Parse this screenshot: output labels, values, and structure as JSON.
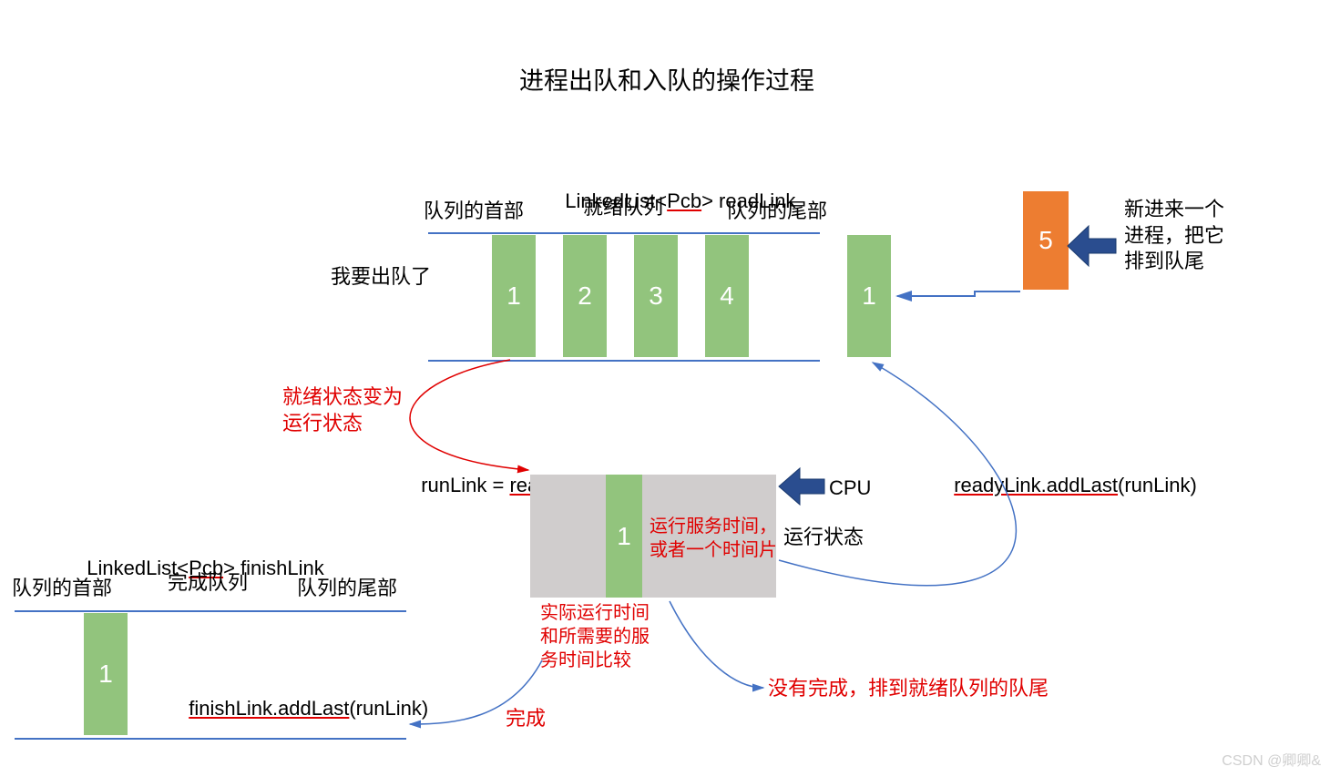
{
  "title": "进程出队和入队的操作过程",
  "readyQueue": {
    "declaration_prefix": "LinkedList<",
    "declaration_type": "Pcb",
    "declaration_suffix": "> readLink",
    "headLabel": "队列的首部",
    "nameLabel": "就绪队列",
    "tailLabel": "队列的尾部",
    "dequeueLabel": "我要出队了",
    "items": [
      "1",
      "2",
      "3",
      "4"
    ],
    "extra": "1"
  },
  "newProcess": {
    "value": "5",
    "caption": "新进来一个\n进程，把它\n排到队尾"
  },
  "transition": {
    "stateChange": "就绪状态变为\n运行状态",
    "runAssign_prefix": "runLink = ",
    "runAssign_call": "readyLink.removeFirst",
    "runAssign_suffix": "()"
  },
  "running": {
    "cpu": "CPU",
    "stateLabel": "运行状态",
    "value": "1",
    "note": "运行服务时间，\n或者一个时间片",
    "compareNote": "实际运行时间\n和所需要的服\n务时间比较",
    "enqueueCall_call": "readyLink.addLast",
    "enqueueCall_arg": "(runLink)",
    "notDone": "没有完成，排到就绪队列的队尾",
    "done": "完成"
  },
  "finishQueue": {
    "declaration_prefix": "LinkedList<",
    "declaration_type": "Pcb",
    "declaration_suffix": "> finishLink",
    "headLabel": "队列的首部",
    "nameLabel": "完成队列",
    "tailLabel": "队列的尾部",
    "item": "1",
    "addCall_call": "finishLink.addLast",
    "addCall_arg": "(runLink)"
  },
  "watermark": "CSDN @卿卿&",
  "colors": {
    "green": "#92c47d",
    "orange": "#ed7d31",
    "gray": "#d0cdcd",
    "blueLine": "#4472c4",
    "red": "#e00000",
    "arrowBlue": "#1f4e9b"
  }
}
